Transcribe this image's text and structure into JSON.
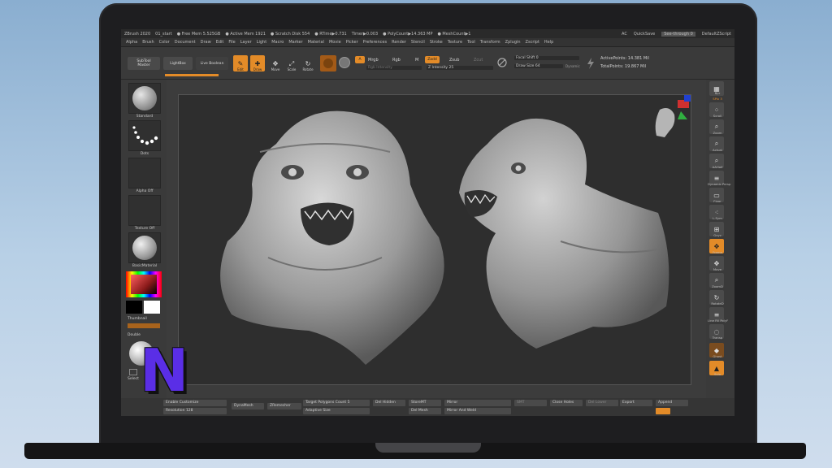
{
  "titlebar": {
    "app": "ZBrush 2020",
    "file": "01_start",
    "stats": [
      "● Free Mem 5.525GB",
      "● Active Mem 1921",
      "● Scratch Disk 554",
      "● RTime▶0.731",
      "Timer▶0.003",
      "● PolyCount▶14.363 MP",
      "● MeshCount▶1"
    ],
    "ac": "AC",
    "quicksave": "QuickSave",
    "see_through": "See-through",
    "see_through_value": "0",
    "layout": "DefaultZScript"
  },
  "menu": [
    "Alpha",
    "Brush",
    "Color",
    "Document",
    "Draw",
    "Edit",
    "File",
    "Layer",
    "Light",
    "Macro",
    "Marker",
    "Material",
    "Movie",
    "Picker",
    "Preferences",
    "Render",
    "Stencil",
    "Stroke",
    "Texture",
    "Tool",
    "Transform",
    "Zplugin",
    "Zscript",
    "Help"
  ],
  "shelf": {
    "subtool_master_line1": "SubTool",
    "subtool_master_line2": "Master",
    "lightbox": "LightBox",
    "live_boolean": "Live Boolean",
    "edit": "Edit",
    "draw": "Draw",
    "move": "Move",
    "scale": "Scale",
    "rotate": "Rotate",
    "a": "A",
    "mrgb": "Mrgb",
    "rgb": "Rgb",
    "m": "M",
    "zadd": "Zadd",
    "zsub": "Zsub",
    "zcut": "Zcut",
    "rgb_intensity": "Rgb Intensity",
    "z_intensity": "Z Intensity 25",
    "focal_shift": "Focal Shift 0",
    "draw_size": "Draw Size 64",
    "dynamic": "Dynamic",
    "active_points": "ActivePoints: 14.381 Mil",
    "total_points": "TotalPoints: 19.867 Mil"
  },
  "left_panel": {
    "brush": "Standard",
    "stroke": "Dots",
    "alpha": "Alpha Off",
    "texture": "Texture Off",
    "material": "BasicMaterial",
    "thumbnail": "Thumbnail",
    "double": "Double",
    "select": "Select"
  },
  "right_panel": [
    {
      "icon": "▦",
      "label": "Bpr",
      "name": "bpr"
    },
    {
      "icon": "SPix",
      "label": "SPix 3",
      "name": "spix"
    },
    {
      "icon": "⁘",
      "label": "Scroll",
      "name": "scroll"
    },
    {
      "icon": "⌕",
      "label": "Zoom",
      "name": "zoom"
    },
    {
      "icon": "⌕",
      "label": "Actual",
      "name": "actual"
    },
    {
      "icon": "⌕",
      "label": "AAHalf",
      "name": "aahalf"
    },
    {
      "icon": "≡",
      "label": "Dynamic Persp",
      "name": "persp"
    },
    {
      "icon": "▭",
      "label": "Floor",
      "name": "floor"
    },
    {
      "icon": "⁖",
      "label": "L.Sym",
      "name": "lsym"
    },
    {
      "icon": "⊞",
      "label": "Gxyz",
      "name": "gxyz"
    },
    {
      "icon": "✥",
      "label": "Frame",
      "name": "frame"
    },
    {
      "icon": "✥",
      "label": "Move",
      "name": "move"
    },
    {
      "icon": "⌕",
      "label": "ZoomD",
      "name": "zoomd"
    },
    {
      "icon": "↻",
      "label": "RotateD",
      "name": "rotated"
    },
    {
      "icon": "≡",
      "label": "Line Fill PolyF",
      "name": "polyf"
    },
    {
      "icon": "◌",
      "label": "Transp",
      "name": "transp"
    },
    {
      "icon": "◆",
      "label": "Ghost",
      "name": "ghost"
    },
    {
      "icon": "▲",
      "label": "Solo",
      "name": "solo"
    }
  ],
  "bottom": {
    "enable_customize": "Enable Customize",
    "resolution": "Resolution 128",
    "dynamesh": "DynaMesh",
    "zremesher": "ZRemesher",
    "target_polygons": "Target Polygons Count 5",
    "adaptive": "Adaptive Size",
    "del_hidden": "Del Hidden",
    "del_mesh": "Del Mesh",
    "store_mt": "StoreMT",
    "mirror": "Mirror",
    "mirror_weld": "Mirror And Weld",
    "smt": "SMT",
    "close_holes": "Close Holes",
    "del_lower": "Del Lower",
    "export": "Export",
    "append": "Append"
  },
  "colors": {
    "accent_orange": "#e38b28",
    "logo_purple": "#5a2ee6",
    "sculpt_gray": "#a9a9a9"
  }
}
